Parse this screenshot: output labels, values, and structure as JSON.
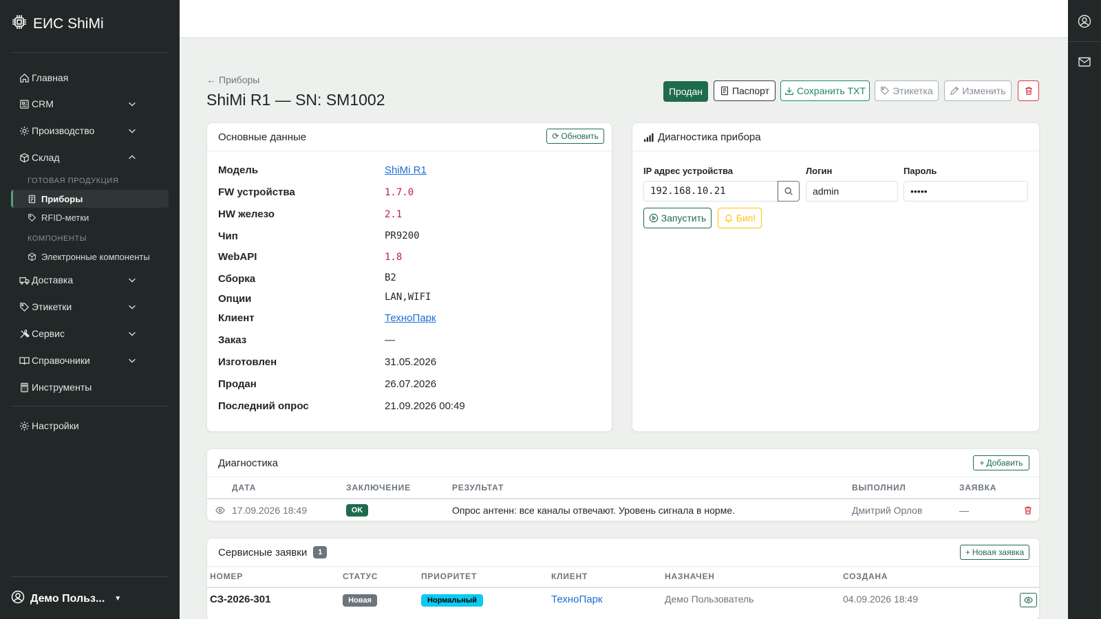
{
  "app": {
    "name": "ЕИС ShiMi"
  },
  "sidebar": {
    "items": [
      {
        "label": "Главная"
      },
      {
        "label": "CRM"
      },
      {
        "label": "Производство"
      },
      {
        "label": "Склад"
      },
      {
        "label": "Доставка"
      },
      {
        "label": "Этикетки"
      },
      {
        "label": "Сервис"
      },
      {
        "label": "Справочники"
      },
      {
        "label": "Инструменты"
      },
      {
        "label": "Настройки"
      }
    ],
    "groups": {
      "finished": "ГОТОВАЯ ПРОДУКЦИЯ",
      "components": "КОМПОНЕНТЫ"
    },
    "subitems": {
      "devices": "Приборы",
      "rfid": "RFID-метки",
      "electronic": "Электронные компоненты"
    },
    "user": "Демо Польз..."
  },
  "header": {
    "back": "Приборы",
    "title": "ShiMi R1 — SN: SM1002",
    "actions": {
      "sold": "Продан",
      "passport": "Паспорт",
      "save_txt": "Сохранить TXT",
      "label": "Этикетка",
      "edit": "Изменить"
    }
  },
  "main_data": {
    "title": "Основные данные",
    "refresh": "Обновить",
    "fields": [
      {
        "key": "Модель",
        "value": "ShiMi R1"
      },
      {
        "key": "FW устройства",
        "value": "1.7.0"
      },
      {
        "key": "HW железо",
        "value": "2.1"
      },
      {
        "key": "Чип",
        "value": "PR9200"
      },
      {
        "key": "WebAPI",
        "value": "1.8"
      },
      {
        "key": "Сборка",
        "value": "B2"
      },
      {
        "key": "Опции",
        "value": "LAN,WIFI"
      },
      {
        "key": "Клиент",
        "value": "ТехноПарк"
      },
      {
        "key": "Заказ",
        "value": "—"
      },
      {
        "key": "Изготовлен",
        "value": "31.05.2026"
      },
      {
        "key": "Продан",
        "value": "26.07.2026"
      },
      {
        "key": "Последний опрос",
        "value": "21.09.2026 00:49"
      }
    ]
  },
  "device_diag": {
    "title": "Диагностика прибора",
    "ip_label": "IP адрес устройства",
    "ip_value": "192.168.10.21",
    "login_label": "Логин",
    "login_value": "admin",
    "password_label": "Пароль",
    "password_value": "•••••",
    "run": "Запустить",
    "beep": "Бип!"
  },
  "diagnostics": {
    "title": "Диагностика",
    "add": "Добавить",
    "columns": [
      "ДАТА",
      "ЗАКЛЮЧЕНИЕ",
      "РЕЗУЛЬТАТ",
      "ВЫПОЛНИЛ",
      "ЗАЯВКА"
    ],
    "rows": [
      {
        "date": "17.09.2026 18:49",
        "conclusion": "OK",
        "result": "Опрос антенн: все каналы отвечают. Уровень сигнала в норме.",
        "by": "Дмитрий Орлов",
        "ticket": "—"
      }
    ]
  },
  "service": {
    "title": "Сервисные заявки",
    "count": "1",
    "new": "Новая заявка",
    "columns": [
      "НОМЕР",
      "СТАТУС",
      "ПРИОРИТЕТ",
      "КЛИЕНТ",
      "НАЗНАЧЕН",
      "СОЗДАНА"
    ],
    "rows": [
      {
        "number": "СЗ-2026-301",
        "status": "Новая",
        "priority": "Нормальный",
        "client": "ТехноПарк",
        "assigned": "Демо Пользователь",
        "created": "04.09.2026 18:49"
      }
    ]
  },
  "colors": {
    "sidebar": "#212827",
    "primary": "#1f6b4e",
    "warning": "#ffc107",
    "danger": "#dc3545",
    "info": "#0dcaf0"
  }
}
